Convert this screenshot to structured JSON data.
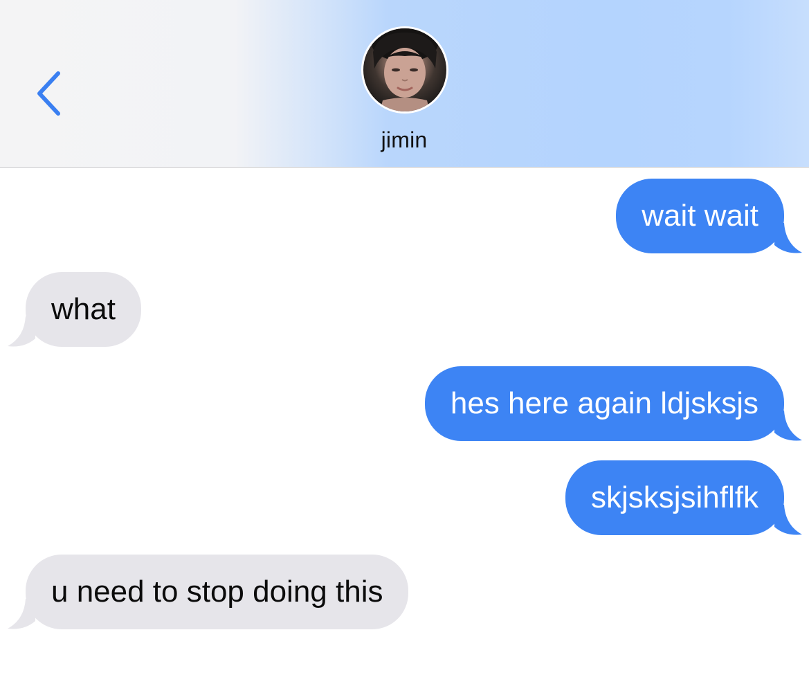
{
  "header": {
    "contact_name": "jimin",
    "back_icon": "chevron-left-icon",
    "avatar_icon": "contact-photo"
  },
  "colors": {
    "accent": "#3d84f4",
    "outgoing_bubble": "#3d84f4",
    "incoming_bubble": "#e6e5ea",
    "header_gradient_start": "#f4f4f5",
    "header_gradient_end": "#b6d5fe",
    "back_chevron": "#3a7ff1"
  },
  "messages": [
    {
      "direction": "outgoing",
      "text": "wait wait"
    },
    {
      "direction": "incoming",
      "text": "what"
    },
    {
      "direction": "outgoing",
      "text": "hes here again ldjsksjs"
    },
    {
      "direction": "outgoing",
      "text": "skjsksjsihflfk"
    },
    {
      "direction": "incoming",
      "text": "u need to stop doing this"
    }
  ]
}
